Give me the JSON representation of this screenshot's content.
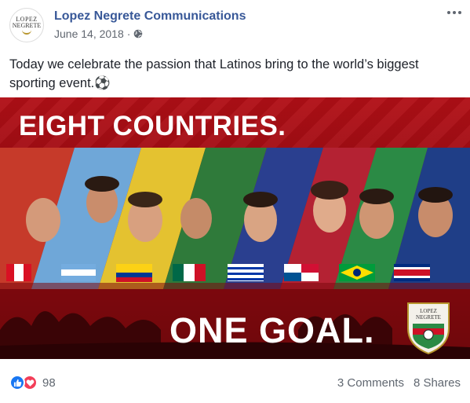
{
  "post": {
    "page_name": "Lopez Negrete Communications",
    "date": "June 14, 2018",
    "separator": "·",
    "privacy_icon": "globe-icon",
    "more_icon": "more-options-icon",
    "avatar": {
      "line1": "LOPEZ",
      "line2": "NEGRETE"
    },
    "caption": "Today we celebrate the passion that Latinos bring to the world’s biggest sporting event.⚽"
  },
  "image": {
    "headline_top": "EIGHT COUNTRIES.",
    "headline_bottom": "ONE GOAL.",
    "flags": [
      "Peru",
      "Argentina",
      "Colombia",
      "Mexico",
      "Uruguay",
      "Panama",
      "Brazil",
      "Costa Rica"
    ],
    "badge": {
      "line1": "LOPEZ",
      "line2": "NEGRETE"
    },
    "colors": {
      "background": "#a50e15",
      "text": "#ffffff"
    }
  },
  "footer": {
    "reaction_icons": [
      "like-icon",
      "love-icon"
    ],
    "reaction_count": "98",
    "comments": "3 Comments",
    "shares": "8 Shares"
  }
}
